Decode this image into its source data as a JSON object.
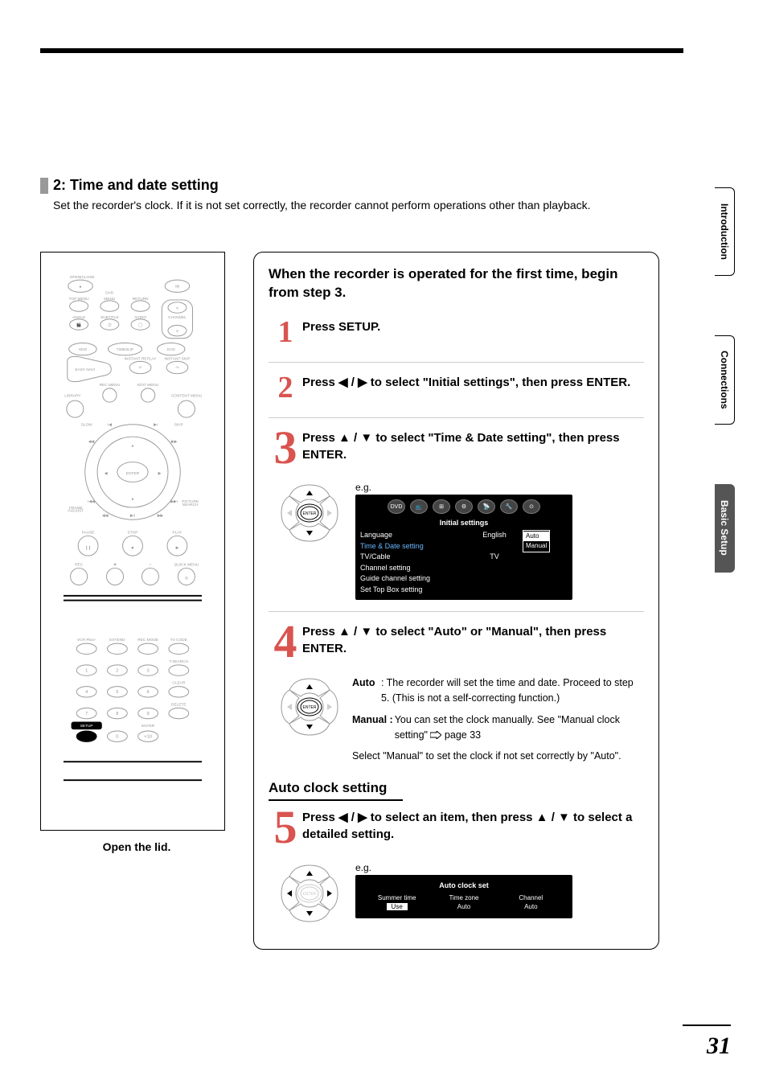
{
  "section": {
    "number_label": "2: Time and date setting",
    "description": "Set the recorder's clock. If it is not set correctly, the recorder cannot perform operations other than playback."
  },
  "tabs": {
    "t1": "Introduction",
    "t2": "Connections",
    "t3": "Basic Setup"
  },
  "remote": {
    "caption": "Open the lid.",
    "labels": {
      "open_close": "OPEN/CLOSE",
      "dvd": "DVD",
      "top_menu": "TOP MENU",
      "menu": "MENU",
      "return": "RETURN",
      "angle": "ANGLE",
      "subtitle": "SUBTITLE",
      "audio": "AUDIO",
      "channel": "CHANNEL",
      "hdd": "HDD",
      "timeslip": "TIMESLIP",
      "dvd2": "DVD",
      "instant_replay": "INSTANT REPLAY",
      "instant_skip": "INSTANT SKIP",
      "easy_navi": "EASY\nNAVI",
      "rec_menu": "REC MENU",
      "edit_menu": "EDIT MENU",
      "library": "LIBRARY",
      "content_menu": "CONTENT MENU",
      "slow": "SLOW",
      "skip": "SKIP",
      "enter": "ENTER",
      "frame": "FRAME",
      "adjust": "ADJUST",
      "picture": "PICTURE",
      "search": "SEARCH",
      "pause": "PAUSE",
      "stop": "STOP",
      "play": "PLAY",
      "rec": "REC",
      "quick_menu": "QUICK MENU",
      "vcr_plus": "VCR Plus+",
      "extend": "EXTEND",
      "rec_mode": "REC MODE",
      "tv_code": "TV CODE",
      "t_search": "T.SEARCH",
      "clear": "CLEAR",
      "delete": "DELETE",
      "setup": "SETUP",
      "enter2": "ENTER",
      "k1": "1",
      "k2": "2",
      "k3": "3",
      "k4": "4",
      "k5": "5",
      "k6": "6",
      "k7": "7",
      "k8": "8",
      "k9": "9",
      "k0": "0",
      "k10": "+10"
    }
  },
  "intro_bold": "When the recorder is operated for the first time, begin from step 3.",
  "steps": {
    "s1": {
      "num": "1",
      "text": "Press SETUP."
    },
    "s2": {
      "num": "2",
      "text": "Press ◀ / ▶ to select \"Initial settings\", then press ENTER."
    },
    "s3": {
      "num": "3",
      "text": "Press ▲ / ▼ to select \"Time & Date setting\", then press ENTER."
    },
    "s4": {
      "num": "4",
      "text": "Press ▲ / ▼ to select \"Auto\" or \"Manual\", then press ENTER."
    },
    "s5": {
      "num": "5",
      "text": "Press ◀ / ▶ to select an item, then press ▲ / ▼ to select a detailed setting."
    }
  },
  "eg_label": "e.g.",
  "osd1": {
    "title": "Initial settings",
    "rows": {
      "language": {
        "label": "Language",
        "value": "English"
      },
      "time_date": {
        "label": "Time & Date setting",
        "value": ""
      },
      "tv_cable": {
        "label": "TV/Cable",
        "value": "TV"
      },
      "channel": {
        "label": "Channel setting",
        "value": ""
      },
      "guide": {
        "label": "Guide channel setting",
        "value": ""
      },
      "stb": {
        "label": "Set Top Box setting",
        "value": ""
      }
    },
    "options": {
      "auto": "Auto",
      "manual": "Manual"
    }
  },
  "explain": {
    "auto_key": "Auto",
    "auto_value": ": The recorder will set the time and date. Proceed to step 5. (This is not a self-correcting function.)",
    "manual_key": "Manual :",
    "manual_value": " You can set the clock manually. See \"Manual clock setting\" ",
    "page_ref": " page 33",
    "note": "Select \"Manual\" to set the clock if not set correctly by \"Auto\"."
  },
  "subhead": "Auto clock setting",
  "osd2": {
    "title": "Auto clock set",
    "cols": {
      "summer": {
        "label": "Summer time",
        "value": "Use"
      },
      "zone": {
        "label": "Time zone",
        "value": "Auto"
      },
      "channel": {
        "label": "Channel",
        "value": "Auto"
      }
    }
  },
  "page_number": "31"
}
